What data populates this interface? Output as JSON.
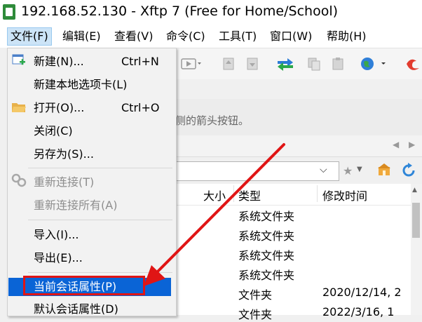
{
  "window": {
    "title": "192.168.52.130 - Xftp 7 (Free for Home/School)"
  },
  "menubar": {
    "items": [
      "文件(F)",
      "编辑(E)",
      "查看(V)",
      "命令(C)",
      "工具(T)",
      "窗口(W)",
      "帮助(H)"
    ]
  },
  "file_menu": {
    "new": {
      "label": "新建(N)...",
      "shortcut": "Ctrl+N"
    },
    "new_local_tab": {
      "label": "新建本地选项卡(L)"
    },
    "open": {
      "label": "打开(O)...",
      "shortcut": "Ctrl+O"
    },
    "close": {
      "label": "关闭(C)"
    },
    "save_as": {
      "label": "另存为(S)..."
    },
    "reconnect": {
      "label": "重新连接(T)"
    },
    "reconnect_all": {
      "label": "重新连接所有(A)"
    },
    "import": {
      "label": "导入(I)..."
    },
    "export": {
      "label": "导出(E)..."
    },
    "current_session_props": {
      "label": "当前会话属性(P)"
    },
    "default_session_props": {
      "label": "默认会话属性(D)"
    }
  },
  "hint": {
    "text": "侧的箭头按钮。"
  },
  "filelist": {
    "columns": [
      "大小",
      "类型",
      "修改时间"
    ],
    "rows": [
      {
        "size": "",
        "type": "系统文件夹",
        "modified": ""
      },
      {
        "size": "",
        "type": "系统文件夹",
        "modified": ""
      },
      {
        "size": "",
        "type": "系统文件夹",
        "modified": ""
      },
      {
        "size": "",
        "type": "系统文件夹",
        "modified": ""
      },
      {
        "size": "",
        "type": "文件夹",
        "modified": "2020/12/14, 2"
      },
      {
        "size": "",
        "type": "文件夹",
        "modified": "2022/3/16, 1"
      }
    ]
  },
  "colors": {
    "highlight": "#0a64d6",
    "annotation_red": "#e01515",
    "menu_active": "#cce4f7"
  }
}
